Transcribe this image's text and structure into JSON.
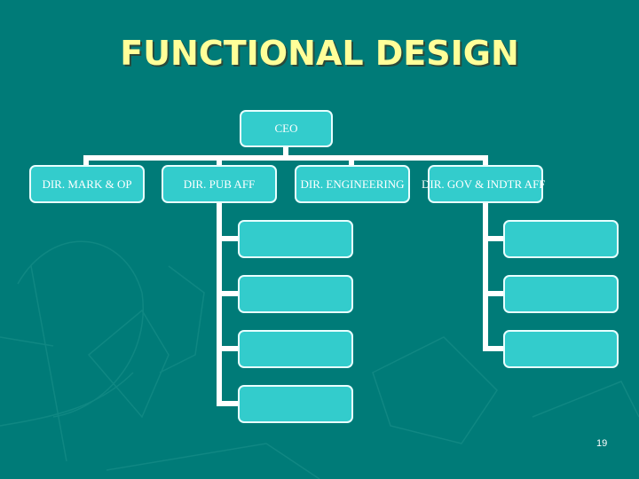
{
  "slide": {
    "title": "FUNCTIONAL DESIGN",
    "page_number": "19",
    "colors": {
      "background": "#007b78",
      "title": "#ffff99",
      "box_fill": "#33cccc",
      "box_border": "#e8ffff",
      "connector": "#ffffff"
    }
  },
  "org_chart": {
    "root": {
      "label": "CEO"
    },
    "directors": [
      {
        "label": "DIR. MARK & OP",
        "children": []
      },
      {
        "label": "DIR. PUB AFF",
        "children": [
          "",
          "",
          "",
          ""
        ]
      },
      {
        "label": "DIR. ENGINEERING",
        "children": []
      },
      {
        "label": "DIR. GOV & INDTR AFF",
        "children": [
          "",
          "",
          ""
        ]
      }
    ]
  }
}
